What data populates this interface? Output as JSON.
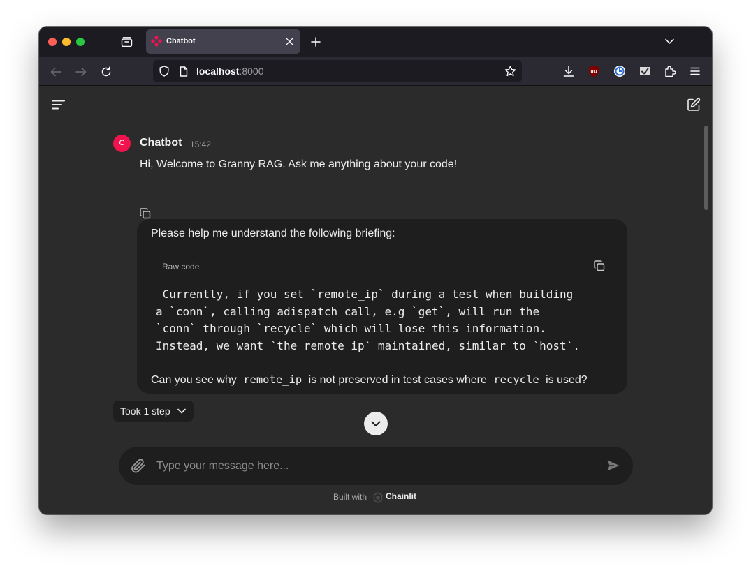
{
  "browser": {
    "tab": {
      "title": "Chatbot"
    },
    "url": {
      "host": "localhost",
      "port": ":8000"
    }
  },
  "message": {
    "author": "Chatbot",
    "avatar_letter": "C",
    "time": "15:42",
    "text": "Hi, Welcome to Granny RAG. Ask me anything about your code!"
  },
  "user_message": {
    "intro": "Please help me understand the following briefing:",
    "code_label": "Raw code",
    "code_lines": [
      " Currently, if you set `remote_ip` during a test when building",
      "a `conn`, calling adispatch call, e.g `get`, will run the",
      "`conn` through `recycle` which will lose this information.",
      "Instead, we want `the remote_ip` maintained, similar to `host`."
    ],
    "question_part1": "Can you see why",
    "question_code1": "remote_ip",
    "question_part2": "is not preserved in test cases where",
    "question_code2": "recycle",
    "question_part3": "is used?"
  },
  "steps": {
    "label": "Took 1 step"
  },
  "composer": {
    "placeholder": "Type your message here..."
  },
  "footer": {
    "built_with": "Built with",
    "brand": "Chainlit"
  },
  "colors": {
    "avatar": "#f0134d",
    "accent": "#f0134d",
    "bubble": "#1e1e1e",
    "background": "#2b2b2b"
  }
}
